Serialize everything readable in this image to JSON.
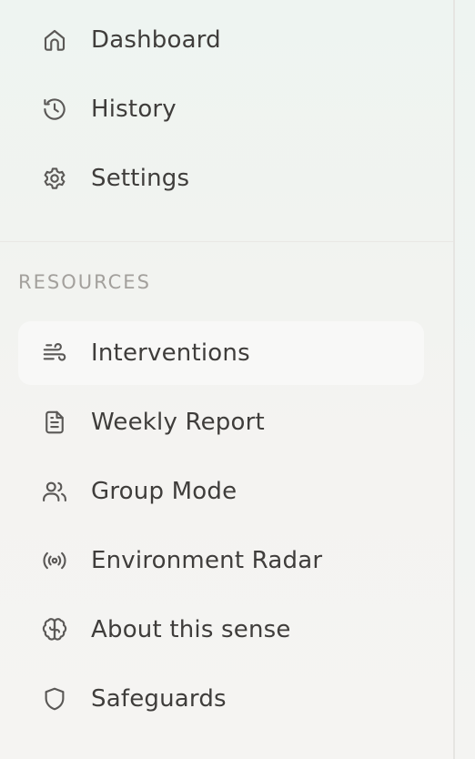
{
  "nav": {
    "primary": [
      {
        "label": "Dashboard",
        "icon": "home-icon"
      },
      {
        "label": "History",
        "icon": "history-icon"
      },
      {
        "label": "Settings",
        "icon": "gear-icon"
      }
    ],
    "resources_heading": "RESOURCES",
    "resources": [
      {
        "label": "Interventions",
        "icon": "wind-icon",
        "active": true
      },
      {
        "label": "Weekly Report",
        "icon": "document-icon"
      },
      {
        "label": "Group Mode",
        "icon": "users-icon"
      },
      {
        "label": "Environment Radar",
        "icon": "radar-icon"
      },
      {
        "label": "About this sense",
        "icon": "brain-icon"
      },
      {
        "label": "Safeguards",
        "icon": "shield-icon"
      }
    ]
  }
}
